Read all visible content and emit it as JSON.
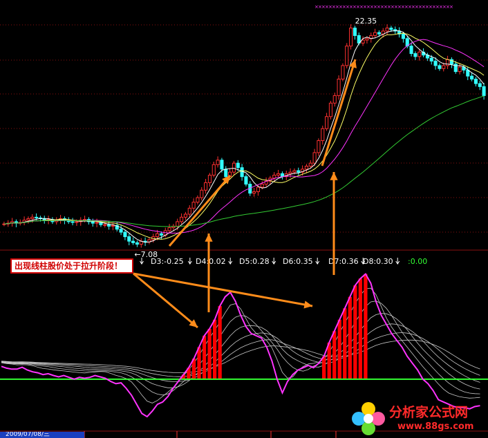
{
  "chart_data": [
    {
      "type": "candlestick",
      "title": "",
      "annotations": [
        {
          "text": "22.35",
          "kind": "high-price-label"
        },
        {
          "text": "←7.08",
          "kind": "low-price-label"
        }
      ],
      "moving_averages": [
        {
          "color": "#ffffff"
        },
        {
          "color": "#ffff66"
        },
        {
          "color": "#ff33ff"
        },
        {
          "color": "#33cc33"
        }
      ],
      "price_range": [
        6.8,
        23.0
      ],
      "candle_count": 120,
      "close": [
        8.45,
        8.5,
        8.6,
        8.5,
        8.55,
        8.7,
        8.8,
        8.9,
        8.85,
        8.8,
        8.7,
        8.75,
        8.6,
        8.7,
        8.8,
        8.7,
        8.6,
        8.55,
        8.6,
        8.7,
        8.75,
        8.6,
        8.5,
        8.55,
        8.4,
        8.4,
        8.3,
        8.35,
        8.1,
        7.9,
        7.6,
        7.3,
        7.2,
        7.1,
        7.3,
        7.25,
        7.4,
        7.6,
        7.8,
        7.7,
        8.0,
        8.2,
        8.3,
        8.6,
        8.9,
        9.1,
        9.5,
        9.9,
        10.2,
        10.7,
        11.2,
        11.7,
        12.4,
        12.7,
        12.1,
        11.6,
        11.9,
        12.5,
        12.2,
        11.6,
        11.1,
        10.5,
        10.6,
        10.9,
        11.1,
        11.3,
        11.5,
        11.7,
        11.8,
        11.6,
        11.8,
        11.9,
        12.0,
        11.9,
        12.1,
        12.3,
        12.5,
        13.2,
        14.0,
        14.8,
        15.6,
        16.5,
        17.0,
        18.1,
        19.0,
        20.3,
        21.5,
        21.0,
        20.5,
        20.7,
        20.8,
        21.0,
        21.2,
        21.1,
        21.3,
        21.5,
        21.4,
        21.3,
        21.1,
        20.8,
        20.3,
        19.8,
        19.6,
        19.9,
        19.7,
        19.5,
        19.3,
        19.0,
        18.8,
        19.0,
        19.4,
        19.1,
        18.6,
        18.9,
        18.7,
        18.3,
        18.1,
        17.8,
        17.6,
        17.0
      ]
    },
    {
      "type": "bar",
      "title": "",
      "indicator_labels": [
        "D3:-0.25",
        "D4:0.02",
        "D5:0.28",
        "D6:0.35",
        "D7:0.36",
        "D8:0.30",
        ":0.00"
      ],
      "highlight_color": "#ff0000",
      "highlight_ranges": [
        [
          35,
          42
        ],
        [
          62,
          70
        ]
      ],
      "main_line_color": "#ff33ff",
      "zero_line_color": "#33ff33",
      "value_range": [
        -1.0,
        2.4
      ],
      "main": [
        0.28,
        0.24,
        0.22,
        0.22,
        0.26,
        0.2,
        0.16,
        0.14,
        0.1,
        0.12,
        0.08,
        0.05,
        0.08,
        0.04,
        0.0,
        0.04,
        0.02,
        0.04,
        0.08,
        0.05,
        0.02,
        -0.05,
        -0.1,
        -0.08,
        -0.2,
        -0.35,
        -0.55,
        -0.75,
        -0.82,
        -0.7,
        -0.55,
        -0.5,
        -0.38,
        -0.2,
        -0.05,
        0.1,
        0.25,
        0.45,
        0.7,
        0.95,
        1.1,
        1.3,
        1.6,
        1.8,
        1.9,
        1.7,
        1.4,
        1.15,
        1.0,
        0.95,
        0.9,
        0.7,
        0.4,
        0.0,
        -0.3,
        -0.05,
        0.1,
        0.2,
        0.25,
        0.3,
        0.25,
        0.35,
        0.5,
        0.8,
        1.05,
        1.3,
        1.55,
        1.8,
        2.05,
        2.2,
        2.3,
        2.1,
        1.7,
        1.4,
        1.2,
        1.0,
        0.85,
        0.7,
        0.5,
        0.35,
        0.2,
        0.0,
        -0.1,
        -0.25,
        -0.45,
        -0.5,
        -0.55,
        -0.6,
        -0.62,
        -0.62,
        -0.65,
        -0.6,
        -0.58
      ],
      "slow_lines_count": 6
    }
  ],
  "callout": {
    "text": "出现线柱股价处于拉升阶段！"
  },
  "date_label": "2009/07/08/三",
  "logo": {
    "text": "分析家公式网",
    "url": "www.88gs.com"
  },
  "colors": {
    "arrow": "#ff8c1a",
    "axis_ticks": "#ff3030"
  }
}
